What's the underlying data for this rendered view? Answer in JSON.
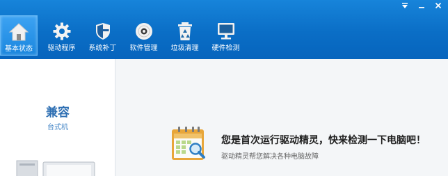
{
  "nav": {
    "items": [
      {
        "label": "基本状态",
        "icon": "home-icon"
      },
      {
        "label": "驱动程序",
        "icon": "gear-icon"
      },
      {
        "label": "系统补丁",
        "icon": "shield-icon"
      },
      {
        "label": "软件管理",
        "icon": "disc-icon"
      },
      {
        "label": "垃圾清理",
        "icon": "recycle-bin-icon"
      },
      {
        "label": "硬件检测",
        "icon": "monitor-icon"
      }
    ],
    "active_index": 0
  },
  "window_controls": [
    "menu-dropdown-icon",
    "minimize-icon",
    "close-icon"
  ],
  "sidebar": {
    "status_title": "兼容",
    "device_type": "台式机"
  },
  "main": {
    "headline": "您是首次运行驱动精灵，快来检测一下电脑吧！",
    "subline": "驱动精灵帮您解决各种电脑故障"
  },
  "colors": {
    "toolbar_blue": "#0a6ec6",
    "active_tab": "#2a92e6",
    "status_blue": "#2e6fb3"
  }
}
